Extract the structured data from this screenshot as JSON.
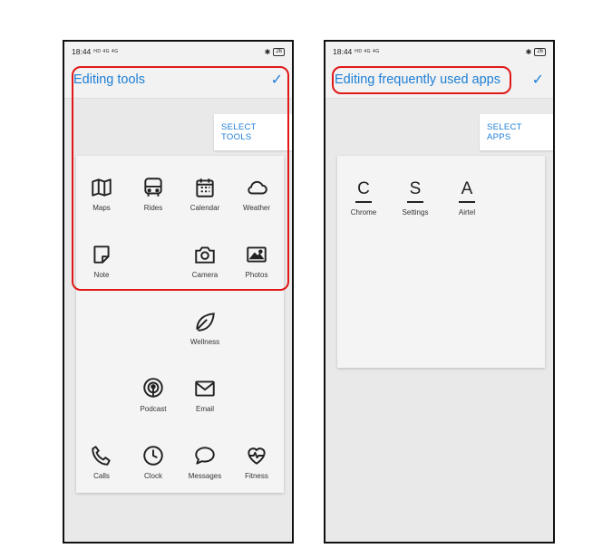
{
  "left_screen": {
    "status": {
      "time": "18:44",
      "network": "HD 4G 4G",
      "battery": "26"
    },
    "appbar": {
      "title": "Editing tools",
      "check": "✓"
    },
    "select_button": "SELECT TOOLS",
    "tools": [
      {
        "label": "Maps",
        "icon": "map-icon"
      },
      {
        "label": "Rides",
        "icon": "bus-icon"
      },
      {
        "label": "Calendar",
        "icon": "calendar-icon"
      },
      {
        "label": "Weather",
        "icon": "cloud-icon"
      },
      {
        "label": "Note",
        "icon": "note-icon"
      },
      {
        "label": "Camera",
        "icon": "camera-icon"
      },
      {
        "label": "Photos",
        "icon": "photo-icon"
      },
      {
        "label": "Wellness",
        "icon": "leaf-icon"
      },
      {
        "label": "Podcast",
        "icon": "podcast-icon"
      },
      {
        "label": "Email",
        "icon": "mail-icon"
      },
      {
        "label": "Calls",
        "icon": "phone-icon"
      },
      {
        "label": "Clock",
        "icon": "clock-icon"
      },
      {
        "label": "Messages",
        "icon": "chat-bubble-icon"
      },
      {
        "label": "Fitness",
        "icon": "heart-pulse-icon"
      }
    ]
  },
  "right_screen": {
    "status": {
      "time": "18:44",
      "network": "HD 4G 4G",
      "battery": "26"
    },
    "appbar": {
      "title": "Editing frequently used apps",
      "check": "✓"
    },
    "select_button": "SELECT APPS",
    "apps": [
      {
        "letter": "C",
        "label": "Chrome"
      },
      {
        "letter": "S",
        "label": "Settings"
      },
      {
        "letter": "A",
        "label": "Airtel"
      }
    ]
  },
  "colors": {
    "accent": "#1e7fd6",
    "highlight": "#e01818",
    "background": "#e9e9e9"
  }
}
